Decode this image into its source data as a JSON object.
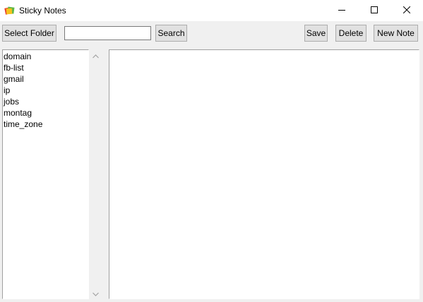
{
  "window": {
    "title": "Sticky Notes",
    "icon": "sticky-notes-app-icon",
    "controls": {
      "minimize": "minimize-icon",
      "maximize": "maximize-icon",
      "close": "close-icon"
    }
  },
  "toolbar": {
    "select_folder_label": "Select Folder",
    "search_value": "",
    "search_placeholder": "",
    "search_label": "Search",
    "save_label": "Save",
    "delete_label": "Delete",
    "new_note_label": "New Note"
  },
  "notes_list": {
    "items": [
      {
        "label": "domain"
      },
      {
        "label": "fb-list"
      },
      {
        "label": "gmail"
      },
      {
        "label": "ip"
      },
      {
        "label": "jobs"
      },
      {
        "label": "montag"
      },
      {
        "label": "time_zone"
      }
    ]
  },
  "editor": {
    "content": ""
  },
  "colors": {
    "window_bg": "#f0f0f0",
    "titlebar_bg": "#ffffff",
    "button_bg": "#e1e1e1",
    "button_border": "#adadad",
    "field_bg": "#ffffff",
    "icon_red": "#e8412c",
    "icon_yellow": "#f6c31c",
    "icon_green": "#5fb846"
  }
}
